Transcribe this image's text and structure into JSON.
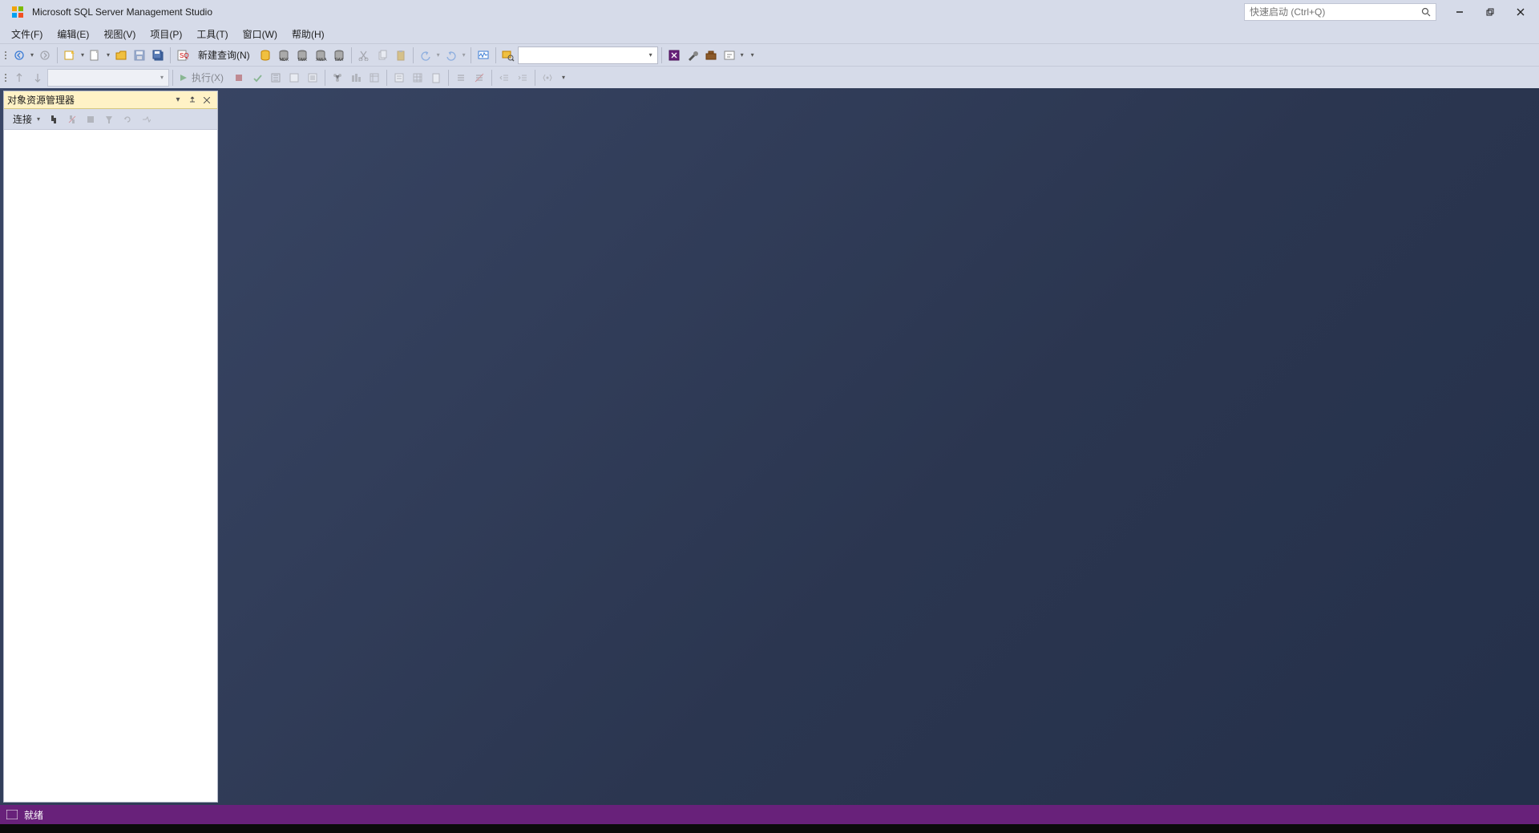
{
  "title": "Microsoft SQL Server Management Studio",
  "quick_launch_placeholder": "快速启动 (Ctrl+Q)",
  "menu": {
    "file": "文件(F)",
    "edit": "编辑(E)",
    "view": "视图(V)",
    "project": "项目(P)",
    "tools": "工具(T)",
    "window": "窗口(W)",
    "help": "帮助(H)"
  },
  "toolbar1": {
    "new_query": "新建查询(N)"
  },
  "toolbar2": {
    "execute": "执行(X)"
  },
  "object_explorer": {
    "title": "对象资源管理器",
    "connect": "连接"
  },
  "status": {
    "ready": "就绪"
  }
}
